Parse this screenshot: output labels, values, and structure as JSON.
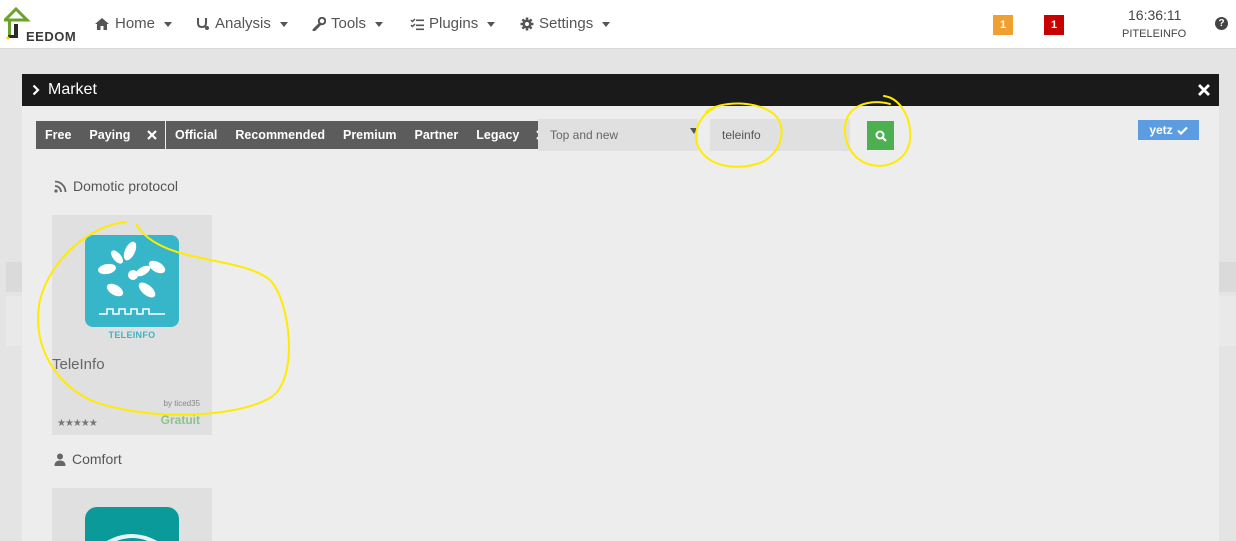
{
  "app": {
    "logo_text": "EEDOM"
  },
  "nav": {
    "items": [
      {
        "label": "Home",
        "icon": "home-icon"
      },
      {
        "label": "Analysis",
        "icon": "stethoscope-icon"
      },
      {
        "label": "Tools",
        "icon": "wrench-icon"
      },
      {
        "label": "Plugins",
        "icon": "tasks-icon"
      },
      {
        "label": "Settings",
        "icon": "gear-icon"
      }
    ],
    "warning_count": "1",
    "error_count": "1",
    "time": "16:36:11",
    "hostname": "PITELEINFO",
    "help_icon": "?"
  },
  "modal": {
    "title": "Market",
    "filters_cost": [
      "Free",
      "Paying"
    ],
    "filters_type": [
      "Official",
      "Recommended",
      "Premium",
      "Partner",
      "Legacy"
    ],
    "sort": {
      "selected": "Top and new"
    },
    "search": {
      "value": "teleinfo"
    },
    "user_button": "yetz",
    "categories": [
      {
        "name": "Domotic protocol",
        "icon": "rss-icon",
        "plugins": [
          {
            "name": "TeleInfo",
            "icon_label": "TELEINFO",
            "author": "by ticed35",
            "price": "Gratuit",
            "stars": "★★★★★"
          }
        ]
      },
      {
        "name": "Comfort",
        "icon": "user-icon",
        "plugins": []
      }
    ]
  },
  "colors": {
    "accent_green": "#4caf50",
    "teleinfo_blue": "#36b6c8",
    "badge_warning": "#f0a030",
    "badge_error": "#c80000",
    "user_button": "#5b9de0",
    "annotation": "#ffeb00"
  }
}
